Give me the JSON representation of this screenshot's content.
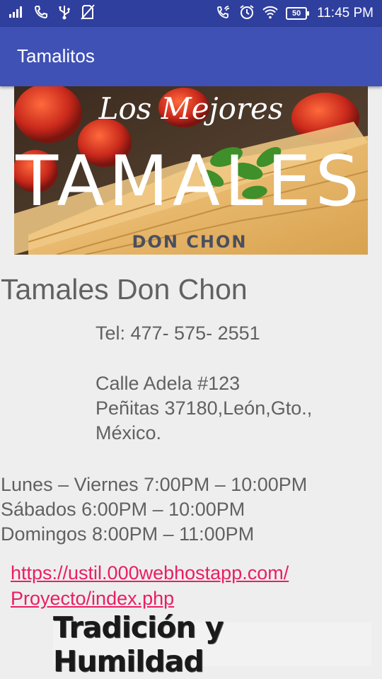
{
  "statusbar": {
    "icons_left": [
      "signal-icon",
      "phone-icon",
      "usb-icon",
      "no-sim-icon"
    ],
    "icons_right": [
      "wifi-call-icon",
      "alarm-icon",
      "wifi-icon",
      "battery-icon"
    ],
    "battery": "50",
    "time": "11:45 PM"
  },
  "appbar": {
    "title": "Tamalitos"
  },
  "banner": {
    "line1": "Los Mejores",
    "line2": "TAMALES",
    "line3": "DON CHON"
  },
  "business": {
    "name": "Tamales Don Chon",
    "phone": "Tel: 477- 575- 2551",
    "address_line1": "Calle Adela #123",
    "address_line2": "Peñitas 37180,León,Gto.,",
    "address_line3": "México."
  },
  "hours": [
    "Lunes – Viernes 7:00PM – 10:00PM",
    "Sábados 6:00PM – 10:00PM",
    "Domingos 8:00PM – 11:00PM"
  ],
  "link": {
    "line1": "https://ustil.000webhostapp.com/",
    "line2": "Proyecto/index.php"
  },
  "slogan": "Tradición y Humildad",
  "colors": {
    "statusbar": "#2f3f9e",
    "appbar": "#3f51b5",
    "link": "#e91e63",
    "text": "#616161",
    "background": "#eeeeee"
  }
}
